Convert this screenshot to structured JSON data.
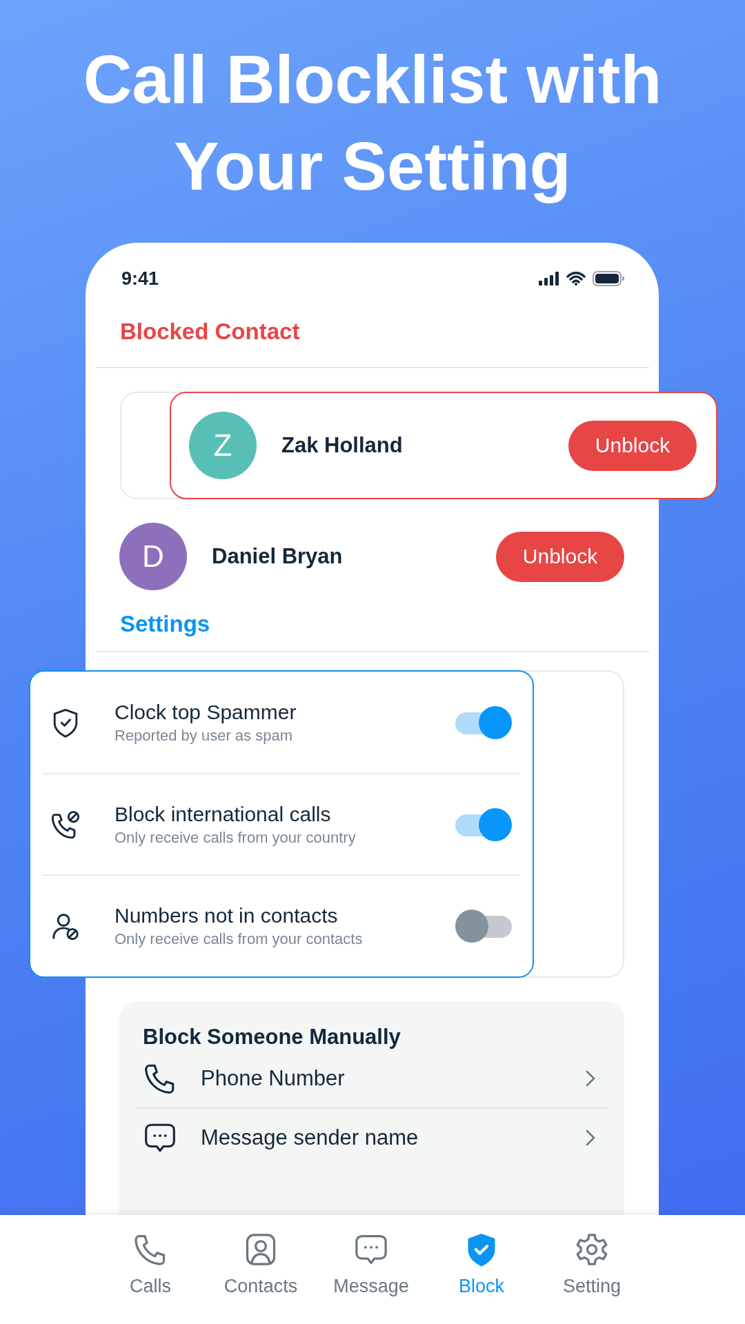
{
  "headline": "Call Blocklist with Your Setting",
  "status_bar": {
    "time": "9:41"
  },
  "blocked_section": {
    "title": "Blocked Contact"
  },
  "blocked_contacts": [
    {
      "initial": "Z",
      "name": "Zak Holland",
      "button": "Unblock",
      "color": "#58bfb6",
      "highlighted": true
    },
    {
      "initial": "D",
      "name": "Daniel Bryan",
      "button": "Unblock",
      "color": "#8e6fbc",
      "highlighted": false
    }
  ],
  "settings_section": {
    "title": "Settings"
  },
  "settings": [
    {
      "kind": "shield",
      "title": "Clock top Spammer",
      "subtitle": "Reported by user as spam",
      "on": true
    },
    {
      "kind": "phone-block",
      "title": "Block international calls",
      "subtitle": "Only receive calls from your country",
      "on": true
    },
    {
      "kind": "person-block",
      "title": "Numbers not in contacts",
      "subtitle": "Only receive calls from your contacts",
      "on": false
    }
  ],
  "manual_block": {
    "title": "Block Someone Manually",
    "items": [
      {
        "kind": "phone",
        "label": "Phone Number"
      },
      {
        "kind": "message",
        "label": "Message sender name"
      }
    ]
  },
  "tabs": [
    {
      "kind": "phone",
      "label": "Calls",
      "selected": false
    },
    {
      "kind": "contact",
      "label": "Contacts",
      "selected": false
    },
    {
      "kind": "message",
      "label": "Message",
      "selected": false
    },
    {
      "kind": "shield",
      "label": "Block",
      "selected": true
    },
    {
      "kind": "gear",
      "label": "Setting",
      "selected": false
    }
  ]
}
